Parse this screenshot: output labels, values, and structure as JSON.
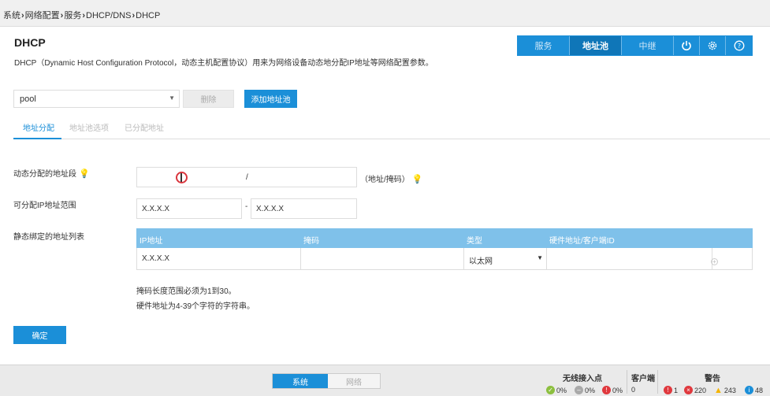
{
  "breadcrumb": [
    "系统",
    "网络配置",
    "服务",
    "DHCP/DNS",
    "DHCP"
  ],
  "page": {
    "title": "DHCP",
    "description": "DHCP（Dynamic Host Configuration Protocol，动态主机配置协议）用来为网络设备动态地分配IP地址等网络配置参数。"
  },
  "topbar": {
    "service": "服务",
    "pool": "地址池",
    "relay": "中继"
  },
  "pool_select": {
    "value": "pool"
  },
  "buttons": {
    "delete": "删除",
    "add_pool": "添加地址池",
    "confirm": "确定"
  },
  "tabs": [
    "地址分配",
    "地址池选项",
    "已分配地址"
  ],
  "form": {
    "dynamic_label": "动态分配的地址段",
    "dynamic_separator": "/",
    "dynamic_hint": "（地址/掩码）",
    "range_label": "可分配IP地址范围",
    "range_start": "X.X.X.X",
    "range_dash": "-",
    "range_end": "X.X.X.X",
    "static_label": "静态绑定的地址列表"
  },
  "table": {
    "headers": [
      "IP地址",
      "掩码",
      "类型",
      "硬件地址/客户端ID"
    ],
    "row": {
      "ip": "X.X.X.X",
      "mask": "",
      "type": "以太网",
      "hw": ""
    }
  },
  "notes": [
    "掩码长度范围必须为1到30。",
    "硬件地址为4-39个字符的字符串。"
  ],
  "footer": {
    "seg_system": "系统",
    "seg_network": "网络",
    "wireless_title": "无线接入点",
    "wireless": [
      "0%",
      "0%",
      "0%"
    ],
    "client_title": "客户端",
    "client_count": "0",
    "alarm_title": "警告",
    "alarms": [
      "1",
      "220",
      "243",
      "48"
    ]
  },
  "colors": {
    "accent": "#1b8fd8",
    "table_header": "#7fc1ea"
  },
  "icons": {
    "power": "power-icon",
    "settings": "gear-icon",
    "help": "help-icon"
  }
}
